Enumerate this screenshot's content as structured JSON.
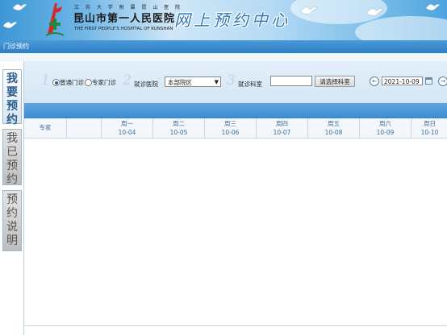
{
  "header": {
    "university_line": "江 苏 大 学 附 属 昆 山 医 院",
    "hospital_name": "昆山市第一人民医院",
    "hospital_english": "THE FIRST PEOPLE'S HOSPITAL OF KUNSHAN",
    "center_title": "网上预约中心"
  },
  "titlebar": {
    "title": "门诊预约"
  },
  "side_tabs": [
    {
      "label": "我要预约",
      "active": true
    },
    {
      "label": "我已预约",
      "active": false
    },
    {
      "label": "预约说明",
      "active": false
    }
  ],
  "steps": {
    "step1": {
      "number": "1",
      "options": [
        {
          "label": "普通门诊",
          "checked": true
        },
        {
          "label": "专家门诊",
          "checked": false
        }
      ]
    },
    "step2": {
      "number": "2",
      "label": "就诊医院",
      "selected": "本部院区"
    },
    "step3": {
      "number": "3",
      "label": "就诊科室",
      "input_value": "",
      "button_label": "请选择科室"
    },
    "date": {
      "prev_icon": "←",
      "value": "2021-10-09",
      "next_icon": "→"
    }
  },
  "schedule": {
    "doctor_header": "专家",
    "days": [
      {
        "weekday": "周一",
        "date": "10-04"
      },
      {
        "weekday": "周二",
        "date": "10-05"
      },
      {
        "weekday": "周三",
        "date": "10-06"
      },
      {
        "weekday": "周四",
        "date": "10-07"
      },
      {
        "weekday": "周五",
        "date": "10-08"
      },
      {
        "weekday": "周六",
        "date": "10-09"
      },
      {
        "weekday": "周日",
        "date": "10-10"
      }
    ]
  },
  "colors": {
    "header_blue": "#3d97d6",
    "titlebar_blue": "#2d7ec5",
    "accent_text": "#3e6f9b"
  }
}
